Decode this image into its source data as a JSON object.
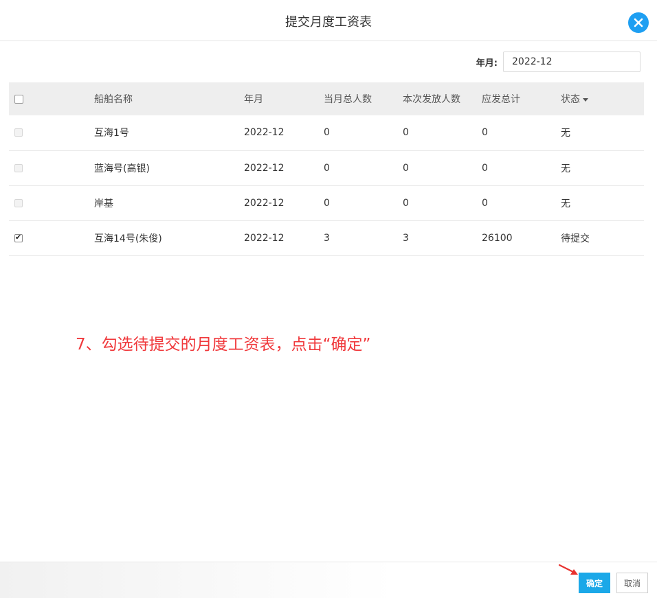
{
  "dialog": {
    "title": "提交月度工资表"
  },
  "filter": {
    "year_month_label": "年月:",
    "year_month_value": "2022-12"
  },
  "table": {
    "headers": {
      "name": "船舶名称",
      "year_month": "年月",
      "total": "当月总人数",
      "issue": "本次发放人数",
      "amount": "应发总计",
      "status": "状态"
    },
    "rows": [
      {
        "checked": false,
        "disabled": true,
        "name": "互海1号",
        "year_month": "2022-12",
        "total": "0",
        "issue": "0",
        "amount": "0",
        "status": "无"
      },
      {
        "checked": false,
        "disabled": true,
        "name": "蓝海号(高银)",
        "year_month": "2022-12",
        "total": "0",
        "issue": "0",
        "amount": "0",
        "status": "无"
      },
      {
        "checked": false,
        "disabled": true,
        "name": "岸基",
        "year_month": "2022-12",
        "total": "0",
        "issue": "0",
        "amount": "0",
        "status": "无"
      },
      {
        "checked": true,
        "disabled": false,
        "name": "互海14号(朱俊)",
        "year_month": "2022-12",
        "total": "3",
        "issue": "3",
        "amount": "26100",
        "status": "待提交"
      }
    ]
  },
  "annotation": {
    "text": "7、勾选待提交的月度工资表，点击“确定”",
    "color": "#f0393c"
  },
  "footer": {
    "ok_label": "确定",
    "cancel_label": "取消"
  },
  "colors": {
    "accent": "#1e9ff2",
    "ok_button": "#1ba8e8"
  }
}
